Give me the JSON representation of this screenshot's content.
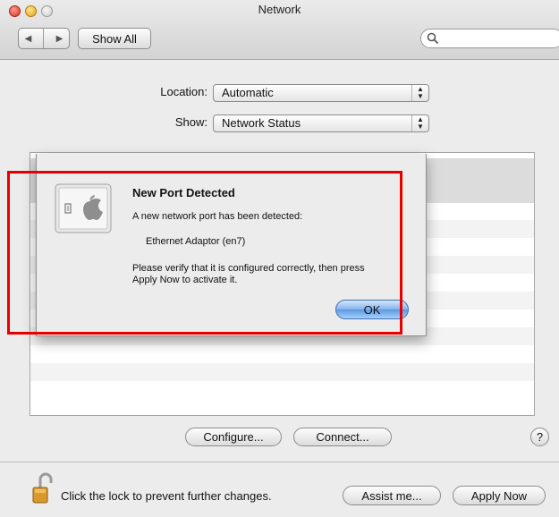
{
  "window": {
    "title": "Network"
  },
  "toolbar": {
    "back_icon": "back-arrow-icon",
    "forward_icon": "forward-arrow-icon",
    "show_all_label": "Show All",
    "search_placeholder": ""
  },
  "form": {
    "location_label": "Location:",
    "location_value": "Automatic",
    "show_label": "Show:",
    "show_value": "Network Status"
  },
  "dialog": {
    "title": "New Port Detected",
    "line1": "A new network port has been detected:",
    "port_name": "Ethernet Adaptor (en7)",
    "message": "Please verify that it is configured correctly, then press Apply Now to activate it.",
    "ok_label": "OK"
  },
  "actions": {
    "configure_label": "Configure...",
    "connect_label": "Connect...",
    "help_label": "?"
  },
  "footer": {
    "lock_text": "Click the lock to prevent further changes.",
    "assist_label": "Assist me...",
    "apply_label": "Apply Now"
  },
  "colors": {
    "highlight": "#e60000",
    "default_button": "#5a98e2"
  }
}
